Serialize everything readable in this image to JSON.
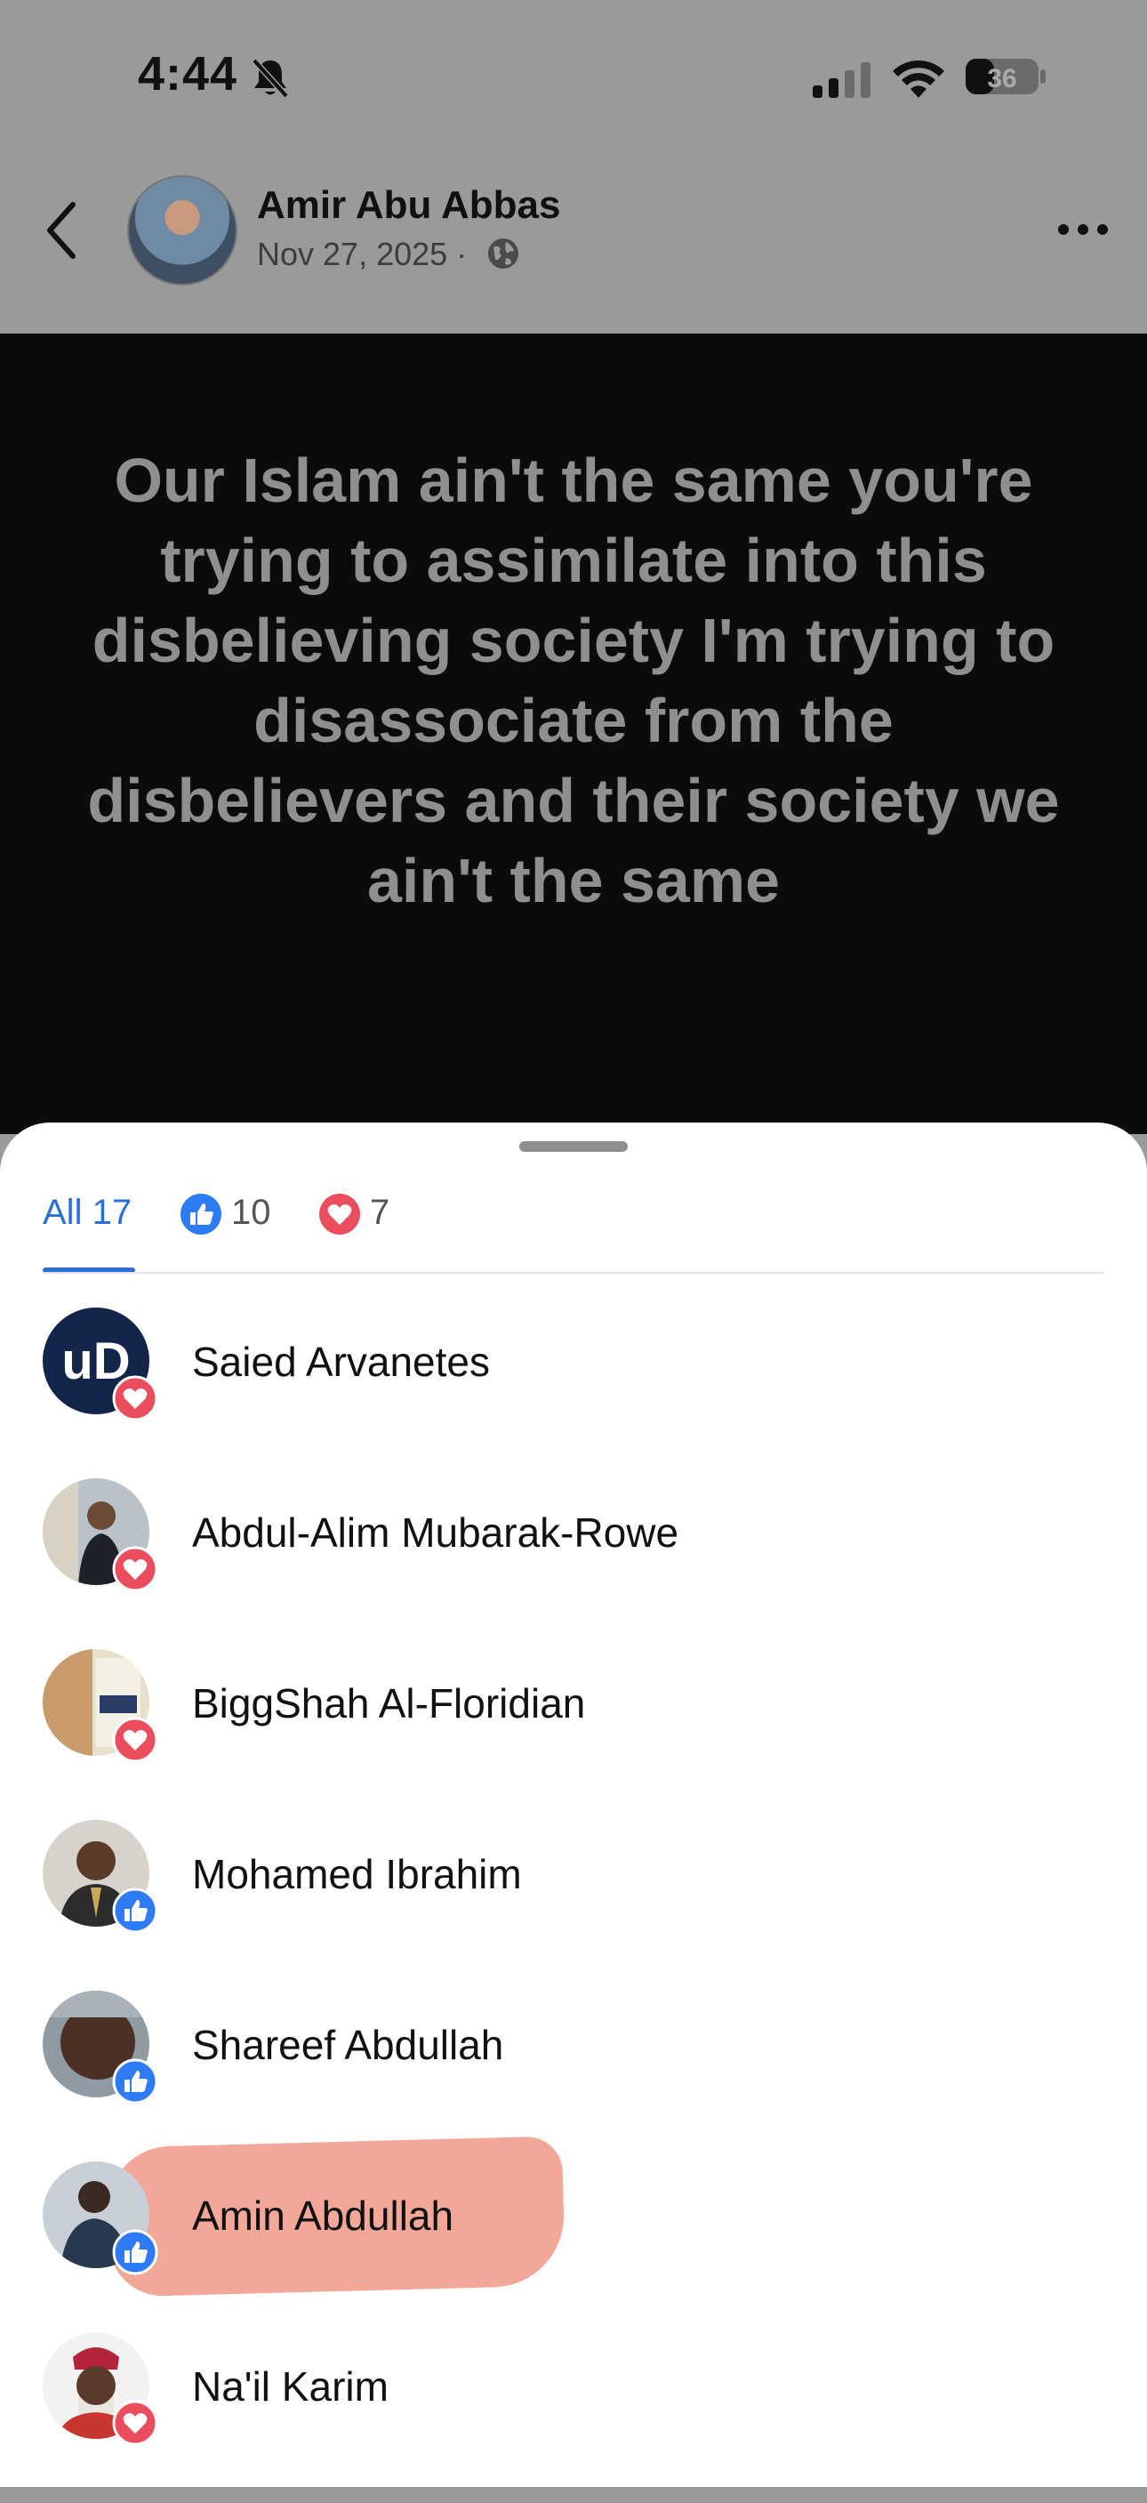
{
  "status_bar": {
    "time": "4:44",
    "battery": "36"
  },
  "post": {
    "author": "Amir Abu Abbas",
    "date": "Nov 27, 2025 ·",
    "text": "Our Islam ain't the same you're trying to assimilate into this disbelieving society I'm trying to disassociate from the disbelievers and their society we ain't the same"
  },
  "reactions": {
    "tabs": {
      "all": "All 17",
      "like": "10",
      "love": "7"
    },
    "people": [
      {
        "name": "Saied Arvanetes",
        "reaction": "love"
      },
      {
        "name": "Abdul-Alim Mubarak-Rowe",
        "reaction": "love"
      },
      {
        "name": "BiggShah Al-Floridian",
        "reaction": "love"
      },
      {
        "name": "Mohamed Ibrahim",
        "reaction": "like"
      },
      {
        "name": "Shareef Abdullah",
        "reaction": "like"
      },
      {
        "name": "Amin Abdullah",
        "reaction": "like"
      },
      {
        "name": "Na'il Karim",
        "reaction": "love"
      }
    ]
  },
  "colors": {
    "accent": "#2b6fd8",
    "like": "#2f7bf5",
    "love": "#ea4d5b",
    "highlight": "#f1a294"
  }
}
